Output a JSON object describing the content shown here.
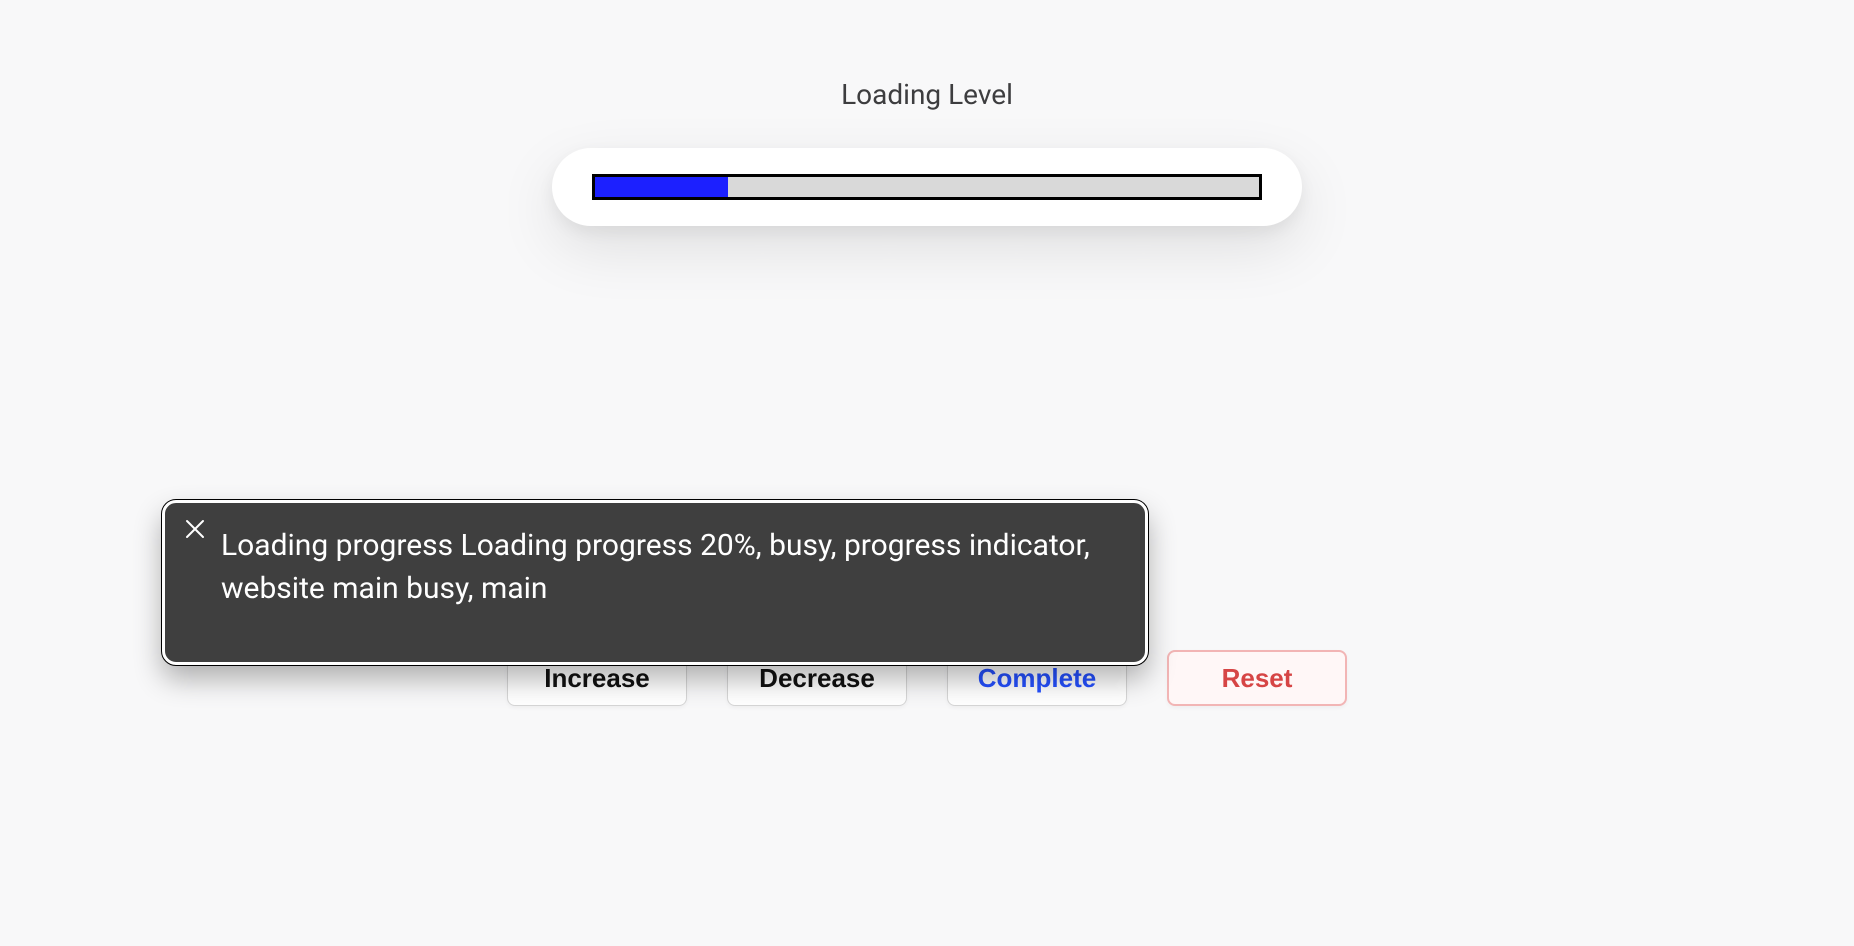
{
  "heading": "Loading Level",
  "progress": {
    "percent": 20,
    "fill_color": "#1c20ff",
    "track_color": "#d9d9d9"
  },
  "buttons": {
    "increase": "Increase",
    "decrease": "Decrease",
    "complete": "Complete",
    "reset": "Reset"
  },
  "tooltip": {
    "text": "Loading progress Loading progress 20%, busy, progress indicator, website main busy, main",
    "close_icon": "close-icon"
  }
}
